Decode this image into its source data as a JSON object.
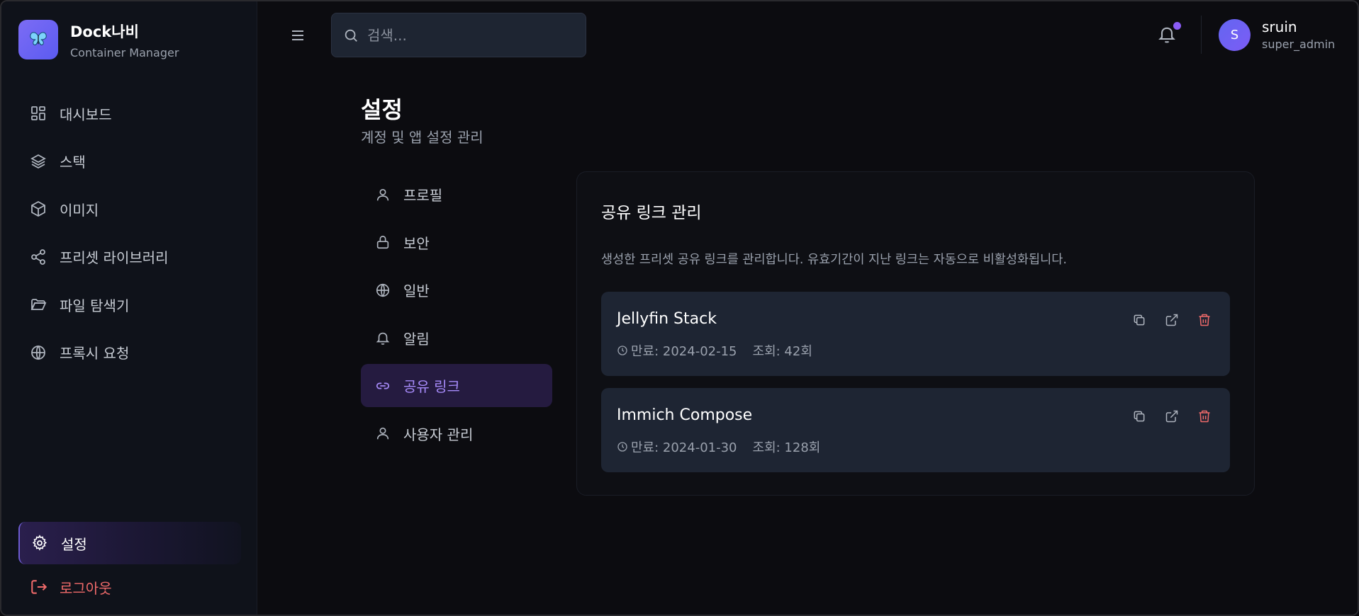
{
  "brand": {
    "name": "Dock나비",
    "subtitle": "Container Manager"
  },
  "sidebar": {
    "items": [
      {
        "label": "대시보드",
        "icon": "dashboard-icon"
      },
      {
        "label": "스택",
        "icon": "layers-icon"
      },
      {
        "label": "이미지",
        "icon": "box-icon"
      },
      {
        "label": "프리셋 라이브러리",
        "icon": "share-icon"
      },
      {
        "label": "파일 탐색기",
        "icon": "folder-icon"
      },
      {
        "label": "프록시 요청",
        "icon": "globe-icon"
      }
    ],
    "settings_label": "설정",
    "logout_label": "로그아웃"
  },
  "header": {
    "search_placeholder": "검색...",
    "user": {
      "name": "sruin",
      "role": "super_admin",
      "initial": "S"
    }
  },
  "page": {
    "title": "설정",
    "subtitle": "계정 및 앱 설정 관리"
  },
  "settings_nav": {
    "items": [
      {
        "label": "프로필",
        "icon": "user-icon"
      },
      {
        "label": "보안",
        "icon": "lock-icon"
      },
      {
        "label": "일반",
        "icon": "globe-icon"
      },
      {
        "label": "알림",
        "icon": "bell-icon"
      },
      {
        "label": "공유 링크",
        "icon": "link-icon",
        "active": true
      },
      {
        "label": "사용자 관리",
        "icon": "user-icon"
      }
    ]
  },
  "share_links": {
    "title": "공유 링크 관리",
    "description": "생성한 프리셋 공유 링크를 관리합니다. 유효기간이 지난 링크는 자동으로 비활성화됩니다.",
    "items": [
      {
        "name": "Jellyfin Stack",
        "expiry": "만료: 2024-02-15",
        "views": "조회: 42회"
      },
      {
        "name": "Immich Compose",
        "expiry": "만료: 2024-01-30",
        "views": "조회: 128회"
      }
    ]
  },
  "colors": {
    "accent": "#8b5cf6",
    "danger": "#f06a6a",
    "card": "#1e2533"
  }
}
